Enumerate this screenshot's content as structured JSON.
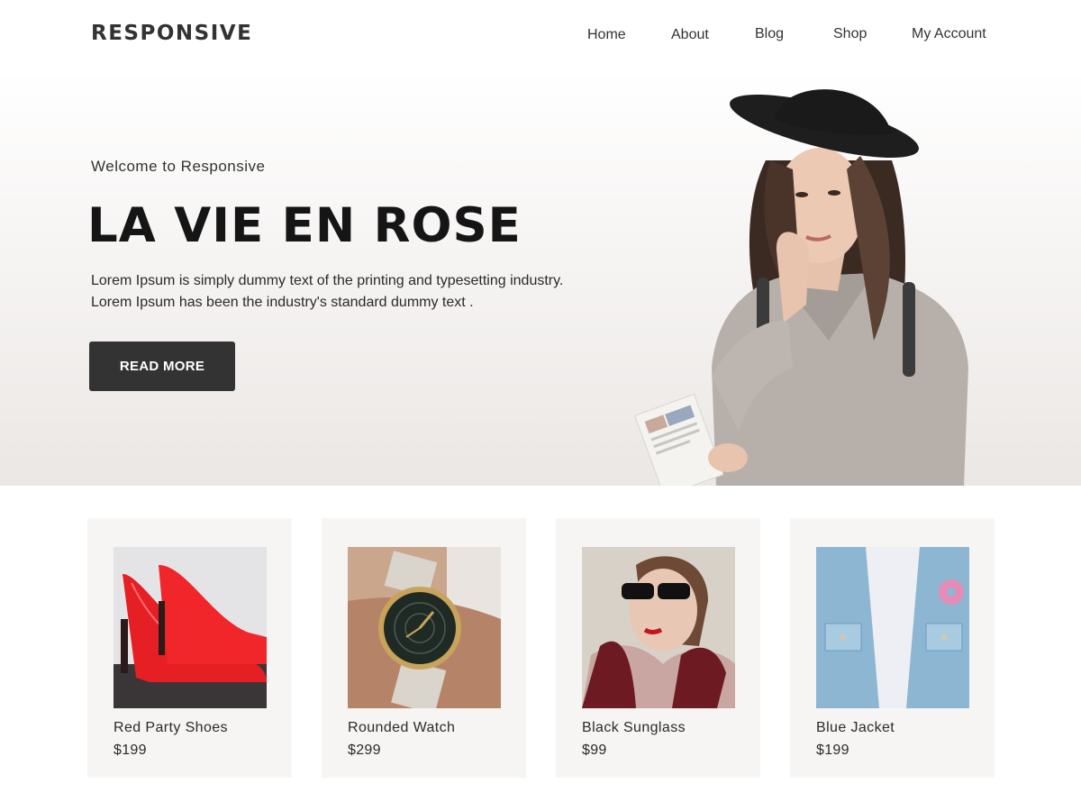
{
  "header": {
    "logo": "RESPONSIVE",
    "nav": {
      "home": "Home",
      "about": "About",
      "blog": "Blog",
      "shop": "Shop",
      "account": "My Account"
    }
  },
  "hero": {
    "welcome": "Welcome to Responsive",
    "title": "LA VIE EN ROSE",
    "description": "Lorem Ipsum is simply dummy text of the printing and typesetting industry. Lorem Ipsum has been the industry's standard dummy text .",
    "button_label": "READ MORE",
    "image": "woman-in-black-hat-photo"
  },
  "products": [
    {
      "name": "Red Party Shoes",
      "price": "$199",
      "image": "red-high-heels-photo"
    },
    {
      "name": "Rounded Watch",
      "price": "$299",
      "image": "wrist-watch-photo"
    },
    {
      "name": "Black Sunglass",
      "price": "$99",
      "image": "woman-sunglasses-photo"
    },
    {
      "name": "Blue Jacket",
      "price": "$199",
      "image": "denim-jacket-photo"
    }
  ],
  "colors": {
    "text": "#333333",
    "button": "#333333",
    "card_background": "#f6f5f3",
    "hero_gradient_bottom": "#ebe7e5"
  }
}
